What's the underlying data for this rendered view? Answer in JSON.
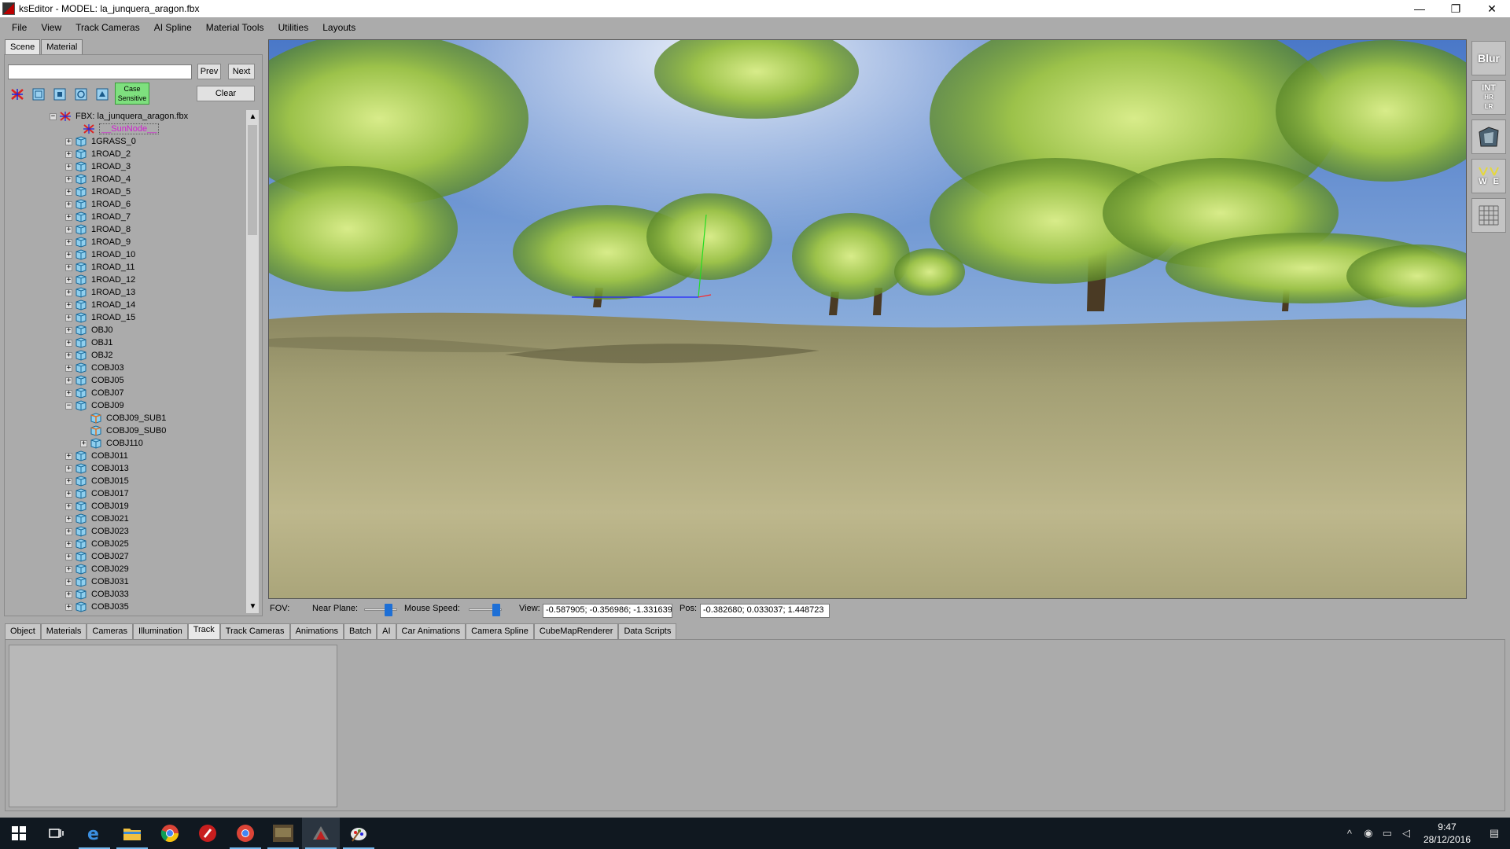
{
  "window": {
    "title": "ksEditor - MODEL: la_junquera_aragon.fbx",
    "controls": [
      "—",
      "❐",
      "✕"
    ]
  },
  "menu": [
    "File",
    "View",
    "Track Cameras",
    "AI Spline",
    "Material Tools",
    "Utilities",
    "Layouts"
  ],
  "left_tabs": [
    "Scene",
    "Material"
  ],
  "search": {
    "value": "",
    "prev_label": "Prev",
    "next_label": "Next",
    "clear_label": "Clear",
    "case_label_1": "Case",
    "case_label_2": "Sensitive"
  },
  "tree": {
    "root": "FBX: la_junquera_aragon.fbx",
    "sun": "__SunNode__",
    "items": [
      "1GRASS_0",
      "1ROAD_2",
      "1ROAD_3",
      "1ROAD_4",
      "1ROAD_5",
      "1ROAD_6",
      "1ROAD_7",
      "1ROAD_8",
      "1ROAD_9",
      "1ROAD_10",
      "1ROAD_11",
      "1ROAD_12",
      "1ROAD_13",
      "1ROAD_14",
      "1ROAD_15",
      "OBJ0",
      "OBJ1",
      "OBJ2",
      "COBJ03",
      "COBJ05",
      "COBJ07",
      "COBJ09"
    ],
    "sub_items": [
      "COBJ09_SUB1",
      "COBJ09_SUB0",
      "COBJ110"
    ],
    "items_after": [
      "COBJ011",
      "COBJ013",
      "COBJ015",
      "COBJ017",
      "COBJ019",
      "COBJ021",
      "COBJ023",
      "COBJ025",
      "COBJ027",
      "COBJ029",
      "COBJ031",
      "COBJ033",
      "COBJ035"
    ]
  },
  "right_toolbar": {
    "blur": "Blur",
    "int": "INT",
    "hr": "HR",
    "lr": "LR",
    "w": "W",
    "e": "E"
  },
  "viewport_status": {
    "fov_label": "FOV:",
    "near_plane_label": "Near Plane:",
    "mouse_speed_label": "Mouse Speed:",
    "view_label": "View:",
    "view_value": "-0.587905; -0.356986; -1.331639",
    "pos_label": "Pos:",
    "pos_value": "-0.382680; 0.033037; 1.448723",
    "near_plane_level": 0.72,
    "mouse_speed_level": 0.82
  },
  "bottom_tabs": [
    "Object",
    "Materials",
    "Cameras",
    "Illumination",
    "Track",
    "Track Cameras",
    "Animations",
    "Batch",
    "AI",
    "Car Animations",
    "Camera Spline",
    "CubeMapRenderer",
    "Data Scripts"
  ],
  "bottom_active": "Track",
  "taskbar": {
    "time": "9:47",
    "date": "28/12/2016"
  },
  "colors": {
    "sky_top": "#4a78c8",
    "sky_bottom": "#c8d8ec",
    "ground": "#b8b080",
    "accent": "#1d6fd6",
    "case_green": "#7ee07e"
  }
}
